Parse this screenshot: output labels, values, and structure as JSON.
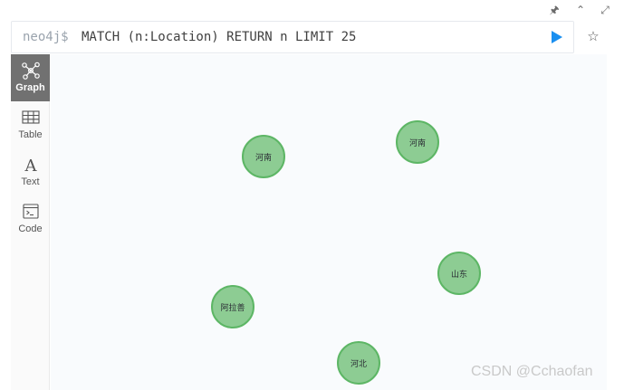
{
  "window": {
    "pin_icon": "pin-icon",
    "collapse_icon": "chevron-up-icon",
    "expand_icon": "expand-icon"
  },
  "editor": {
    "prompt": "neo4j$",
    "query": "MATCH (n:Location) RETURN n LIMIT 25",
    "run_icon": "play-icon",
    "favorite_icon": "star-icon",
    "accent_color": "#1a8ff0"
  },
  "sidebar": {
    "items": [
      {
        "label": "Graph",
        "icon": "graph-icon",
        "active": true
      },
      {
        "label": "Table",
        "icon": "table-icon",
        "active": false
      },
      {
        "label": "Text",
        "icon": "text-icon",
        "active": false
      },
      {
        "label": "Code",
        "icon": "code-icon",
        "active": false
      }
    ]
  },
  "graph": {
    "node_color": "#8dcc93",
    "node_border_color": "#5db665",
    "nodes": [
      {
        "label": "河南"
      },
      {
        "label": "河南"
      },
      {
        "label": "山东"
      },
      {
        "label": "阿拉善"
      },
      {
        "label": "河北"
      }
    ]
  },
  "watermark": "CSDN @Cchaofan"
}
